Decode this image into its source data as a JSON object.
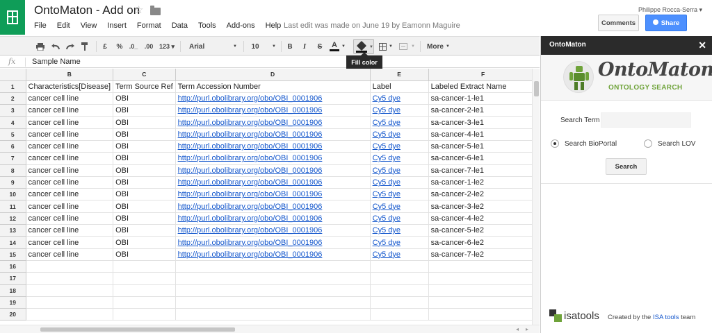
{
  "titlebar": {
    "doc_title": "OntoMaton - Add on",
    "star_glyph": "☆",
    "menu": [
      "File",
      "Edit",
      "View",
      "Insert",
      "Format",
      "Data",
      "Tools",
      "Add-ons",
      "Help"
    ],
    "last_edit": "Last edit was made on June 19 by Eamonn Maguire",
    "user": "Philippe Rocca-Serra ▾",
    "comments_label": "Comments",
    "share_label": "Share"
  },
  "toolbar": {
    "currency": "£",
    "percent": "%",
    "dec_less": ".0_",
    "dec_more": ".00",
    "number_format": "123 ▾",
    "font": "Arial",
    "font_size": "10",
    "bold": "B",
    "italic": "I",
    "strike": "S",
    "text_color": "A",
    "more_label": "More",
    "tooltip": "Fill color",
    "icons": [
      "print-icon",
      "undo-icon",
      "redo-icon",
      "paint-format-icon",
      "fill-color-icon",
      "borders-icon",
      "merge-cells-icon"
    ]
  },
  "formula": {
    "fx": "fx",
    "value": "Sample Name"
  },
  "grid": {
    "columns": [
      "B",
      "C",
      "D",
      "E",
      "F"
    ],
    "header_row": [
      "Characteristics[Disease]",
      "Term Source Ref",
      "Term Accession Number",
      "Label",
      "Labeled Extract Name"
    ],
    "data_rows": [
      [
        "cancer cell line",
        "OBI",
        "http://purl.obolibrary.org/obo/OBI_0001906",
        "Cy5 dye",
        "sa-cancer-1-le1"
      ],
      [
        "cancer cell line",
        "OBI",
        "http://purl.obolibrary.org/obo/OBI_0001906",
        "Cy5 dye",
        "sa-cancer-2-le1"
      ],
      [
        "cancer cell line",
        "OBI",
        "http://purl.obolibrary.org/obo/OBI_0001906",
        "Cy5 dye",
        "sa-cancer-3-le1"
      ],
      [
        "cancer cell line",
        "OBI",
        "http://purl.obolibrary.org/obo/OBI_0001906",
        "Cy5 dye",
        "sa-cancer-4-le1"
      ],
      [
        "cancer cell line",
        "OBI",
        "http://purl.obolibrary.org/obo/OBI_0001906",
        "Cy5 dye",
        "sa-cancer-5-le1"
      ],
      [
        "cancer cell line",
        "OBI",
        "http://purl.obolibrary.org/obo/OBI_0001906",
        "Cy5 dye",
        "sa-cancer-6-le1"
      ],
      [
        "cancer cell line",
        "OBI",
        "http://purl.obolibrary.org/obo/OBI_0001906",
        "Cy5 dye",
        "sa-cancer-7-le1"
      ],
      [
        "cancer cell line",
        "OBI",
        "http://purl.obolibrary.org/obo/OBI_0001906",
        "Cy5 dye",
        "sa-cancer-1-le2"
      ],
      [
        "cancer cell line",
        "OBI",
        "http://purl.obolibrary.org/obo/OBI_0001906",
        "Cy5 dye",
        "sa-cancer-2-le2"
      ],
      [
        "cancer cell line",
        "OBI",
        "http://purl.obolibrary.org/obo/OBI_0001906",
        "Cy5 dye",
        "sa-cancer-3-le2"
      ],
      [
        "cancer cell line",
        "OBI",
        "http://purl.obolibrary.org/obo/OBI_0001906",
        "Cy5 dye",
        "sa-cancer-4-le2"
      ],
      [
        "cancer cell line",
        "OBI",
        "http://purl.obolibrary.org/obo/OBI_0001906",
        "Cy5 dye",
        "sa-cancer-5-le2"
      ],
      [
        "cancer cell line",
        "OBI",
        "http://purl.obolibrary.org/obo/OBI_0001906",
        "Cy5 dye",
        "sa-cancer-6-le2"
      ],
      [
        "cancer cell line",
        "OBI",
        "http://purl.obolibrary.org/obo/OBI_0001906",
        "Cy5 dye",
        "sa-cancer-7-le2"
      ]
    ],
    "row_numbers": [
      "1",
      "2",
      "3",
      "4",
      "5",
      "6",
      "7",
      "8",
      "9",
      "10",
      "11",
      "12",
      "13",
      "14",
      "15",
      "16",
      "17",
      "18",
      "19",
      "20"
    ],
    "link_color": "#1155cc"
  },
  "sidebar": {
    "title": "OntoMaton",
    "close": "✕",
    "logo_text": "OntoMaton",
    "logo_sub": "ONTOLOGY SEARCH",
    "search_label": "Search Term",
    "search_value": "",
    "radio_bioportal": "Search BioPortal",
    "radio_lov": "Search LOV",
    "selected_source": "Search BioPortal",
    "search_button": "Search",
    "isa_word": "isatools",
    "credit_prefix": "Created by the",
    "credit_link": "ISA tools",
    "credit_suffix": "team",
    "accent": "#6fa33a"
  }
}
